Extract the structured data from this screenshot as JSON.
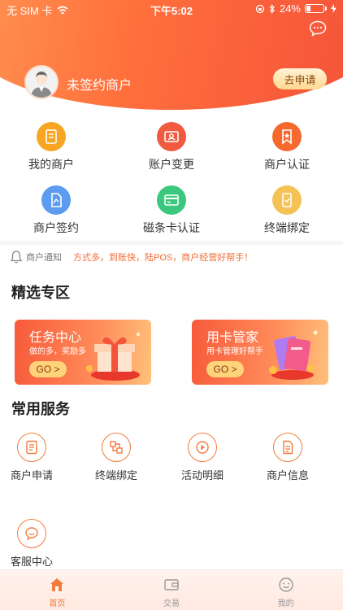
{
  "status_bar": {
    "carrier": "无 SIM 卡",
    "time": "下午5:02",
    "battery": "24%",
    "battery_level": 0.24
  },
  "header": {
    "user_name": "未签约商户",
    "apply_label": "去申请"
  },
  "grid": [
    {
      "label": "我的商户",
      "icon": "merchant-icon",
      "color": "#f6a623"
    },
    {
      "label": "账户变更",
      "icon": "account-change-icon",
      "color": "#ef5a40"
    },
    {
      "label": "商户认证",
      "icon": "certification-icon",
      "color": "#f5692f"
    },
    {
      "label": "商户签约",
      "icon": "contract-icon",
      "color": "#5b9cf0"
    },
    {
      "label": "磁条卡认证",
      "icon": "card-icon",
      "color": "#3cc77e"
    },
    {
      "label": "终端绑定",
      "icon": "terminal-icon",
      "color": "#f5c355"
    }
  ],
  "notice": {
    "label": "商户通知",
    "text": "方式多，到账快，陆POS，商户经营好帮手！"
  },
  "featured": {
    "title": "精选专区",
    "cards": [
      {
        "title": "任务中心",
        "subtitle": "做的多，奖励多",
        "go": "GO >"
      },
      {
        "title": "用卡管家",
        "subtitle": "用卡管理好帮手",
        "go": "GO >"
      }
    ]
  },
  "services": {
    "title": "常用服务",
    "items": [
      {
        "label": "商户申请",
        "icon": "apply-doc-icon"
      },
      {
        "label": "终端绑定",
        "icon": "bind-icon"
      },
      {
        "label": "活动明细",
        "icon": "play-icon"
      },
      {
        "label": "商户信息",
        "icon": "info-doc-icon"
      },
      {
        "label": "客服中心",
        "icon": "chat-icon"
      }
    ]
  },
  "tabbar": [
    {
      "label": "首页",
      "icon": "home-icon",
      "active": true
    },
    {
      "label": "交易",
      "icon": "wallet-icon",
      "active": false
    },
    {
      "label": "我的",
      "icon": "profile-icon",
      "active": false
    }
  ],
  "colors": {
    "accent": "#f47a3e",
    "header_start": "#ff9a56",
    "header_end": "#f4513a",
    "notice_text": "#f26a35"
  }
}
